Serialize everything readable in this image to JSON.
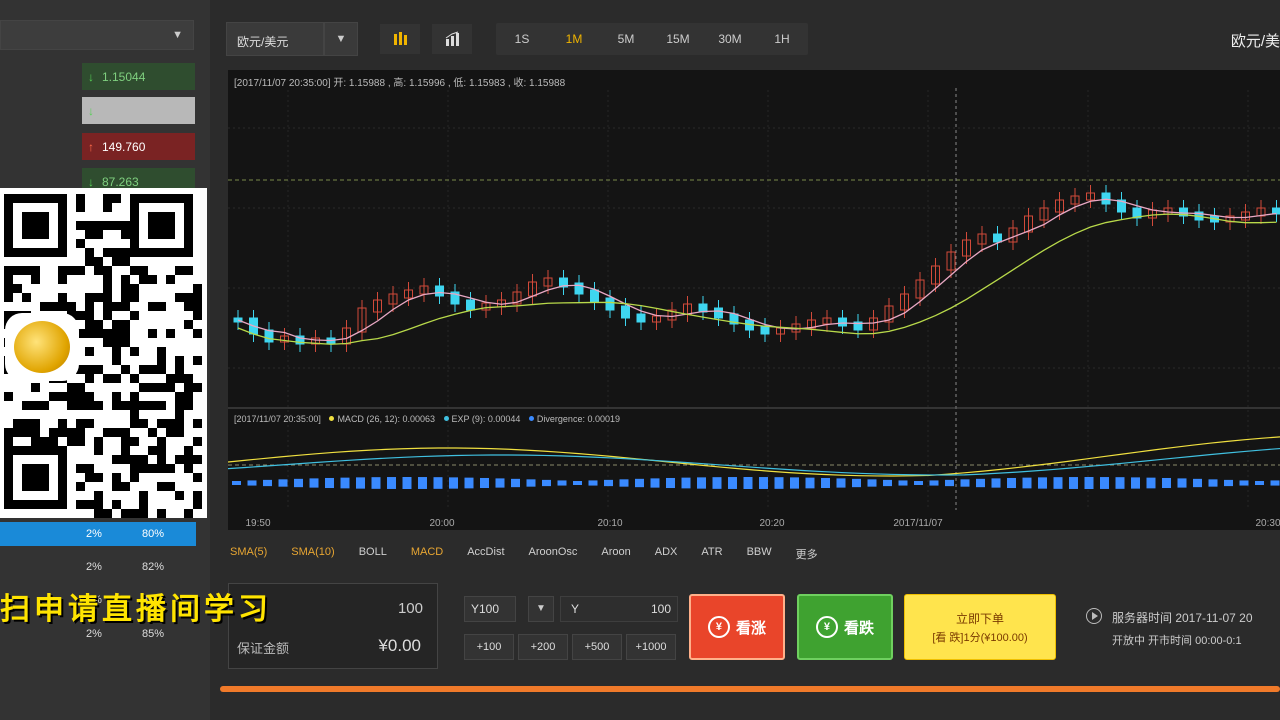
{
  "left": {
    "quotes": [
      {
        "direction": "down",
        "value": "1.15044",
        "style": "green"
      },
      {
        "direction": "down",
        "value": "",
        "style": "light"
      },
      {
        "direction": "up",
        "value": "149.760",
        "style": "red"
      },
      {
        "direction": "down",
        "value": "87.263",
        "style": "green"
      }
    ],
    "pct_rows": [
      {
        "a": "2%",
        "b": "80%",
        "selected": true
      },
      {
        "a": "2%",
        "b": "82%",
        "selected": false
      },
      {
        "a": "2%",
        "b": "85%",
        "selected": false
      },
      {
        "a": "2%",
        "b": "85%",
        "selected": false
      }
    ],
    "promo_text": "扫申请直播间学习",
    "margin_top_value": "100",
    "margin_label": "保证金额",
    "margin_value": "¥0.00"
  },
  "toolbar": {
    "symbol": "欧元/美元",
    "timeframes": [
      "1S",
      "1M",
      "5M",
      "15M",
      "30M",
      "1H"
    ],
    "active_timeframe": "1M",
    "pair_title": "欧元/美"
  },
  "chart": {
    "ohlc_info": "[2017/11/07 20:35:00] 开: 1.15988 , 高: 1.15996 , 低: 1.15983 , 收: 1.15988",
    "macd_datetime": "[2017/11/07 20:35:00]",
    "macd_label": "MACD (26, 12): 0.00063",
    "exp_label": "EXP (9): 0.00044",
    "div_label": "Divergence: 0.00019",
    "x_ticks": [
      "19:50",
      "20:00",
      "20:10",
      "20:20",
      "2017/11/07",
      "20:30"
    ],
    "colors": {
      "up": "#d24a3a",
      "down": "#3ed6f0",
      "ma_fast": "#e9a8c4",
      "ma_slow": "#b8d94a",
      "macd": "#f0e040",
      "signal": "#40c0e0",
      "hist": "#3a8aff"
    }
  },
  "indicators": [
    "SMA(5)",
    "SMA(10)",
    "BOLL",
    "MACD",
    "AccDist",
    "AroonOsc",
    "Aroon",
    "ADX",
    "ATR",
    "BBW",
    "更多"
  ],
  "active_indicators": [
    "SMA(5)",
    "SMA(10)",
    "MACD"
  ],
  "amount": {
    "selected": "Y100",
    "input_prefix": "Y",
    "input_value": "100",
    "quick": [
      "+100",
      "+200",
      "+500",
      "+1000"
    ]
  },
  "trade": {
    "up_label": "看涨",
    "down_label": "看跌",
    "yen": "¥",
    "order_label": "立即下单",
    "order_sub": "[看 跌]1分(¥100.00)"
  },
  "order_info": {
    "line1": "服务器时间 2017-11-07 20",
    "line2": "开放中  开市时间 00:00-0:1"
  }
}
